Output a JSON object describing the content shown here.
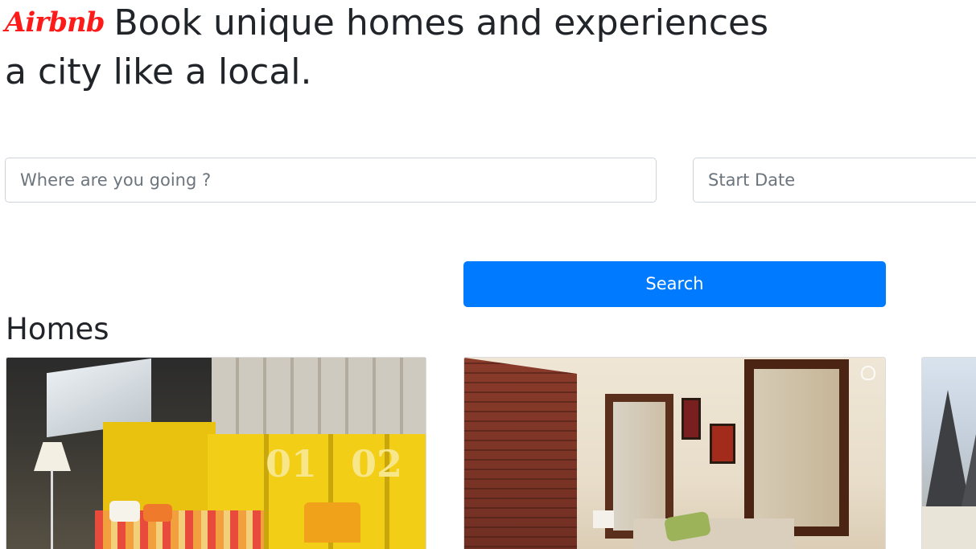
{
  "header": {
    "logo_text": "Airbnb",
    "line1": "Book unique homes and experiences",
    "line2": "a city like a local."
  },
  "search": {
    "where_placeholder": "Where are you going ?",
    "start_date_placeholder": "Start Date",
    "button_label": "Search"
  },
  "homes": {
    "title": "Homes"
  },
  "colors": {
    "brand": "#ff1a1a",
    "primary_button": "#007bff",
    "text": "#212529",
    "placeholder": "#6c757d",
    "input_border": "#ced4da"
  },
  "icons": [
    "airbnb-logo",
    "airbnb-watermark-icon"
  ]
}
